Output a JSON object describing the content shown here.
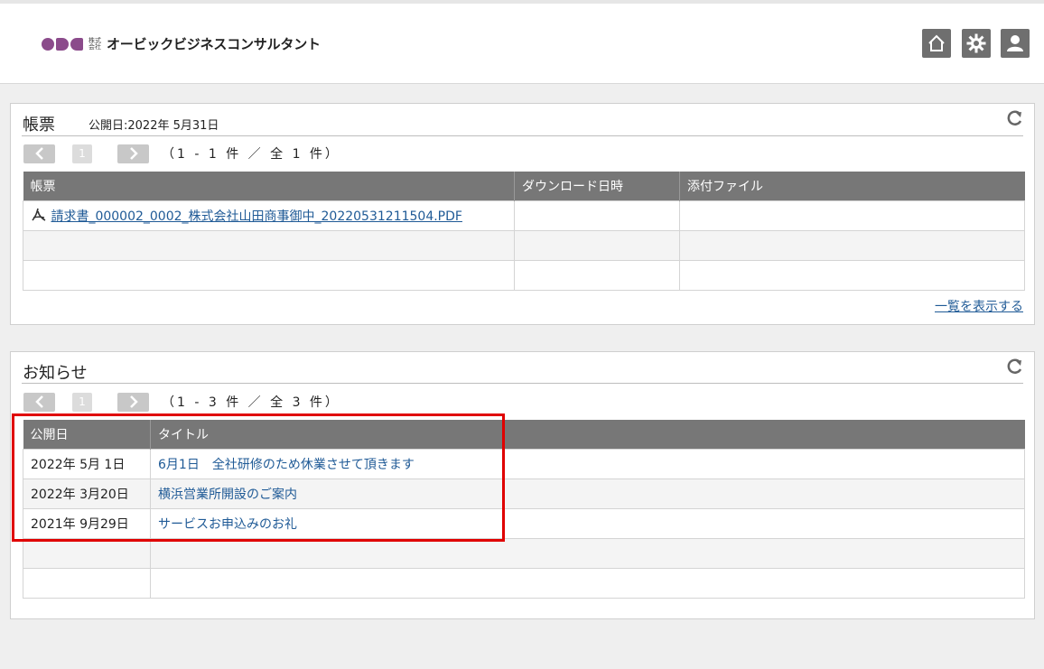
{
  "header": {
    "logo_mark": "OBC",
    "logo_small": "株式会社",
    "company_name": "オービックビジネスコンサルタント",
    "icons": [
      "home-icon",
      "gear-icon",
      "user-icon"
    ]
  },
  "invoices": {
    "title": "帳票",
    "published": "公開日:2022年 5月31日",
    "page": "1",
    "count": "（1 - 1 件 ／ 全 1 件）",
    "columns": [
      "帳票",
      "ダウンロード日時",
      "添付ファイル"
    ],
    "rows": [
      {
        "file": "請求書_000002_0002_株式会社山田商事御中_20220531211504.PDF",
        "downloaded": "",
        "attachment": ""
      }
    ],
    "show_all": "一覧を表示する"
  },
  "notices": {
    "title": "お知らせ",
    "page": "1",
    "count": "（1 - 3 件 ／ 全 3 件）",
    "columns": [
      "公開日",
      "タイトル"
    ],
    "rows": [
      {
        "date": "2022年 5月 1日",
        "title": "6月1日　全社研修のため休業させて頂きます"
      },
      {
        "date": "2022年 3月20日",
        "title": "横浜営業所開設のご案内"
      },
      {
        "date": "2021年 9月29日",
        "title": "サービスお申込みのお礼"
      }
    ]
  },
  "colors": {
    "header_row": "#777777",
    "link": "#1f5a96",
    "highlight": "#e00000",
    "logo": "#8b4b8b"
  }
}
